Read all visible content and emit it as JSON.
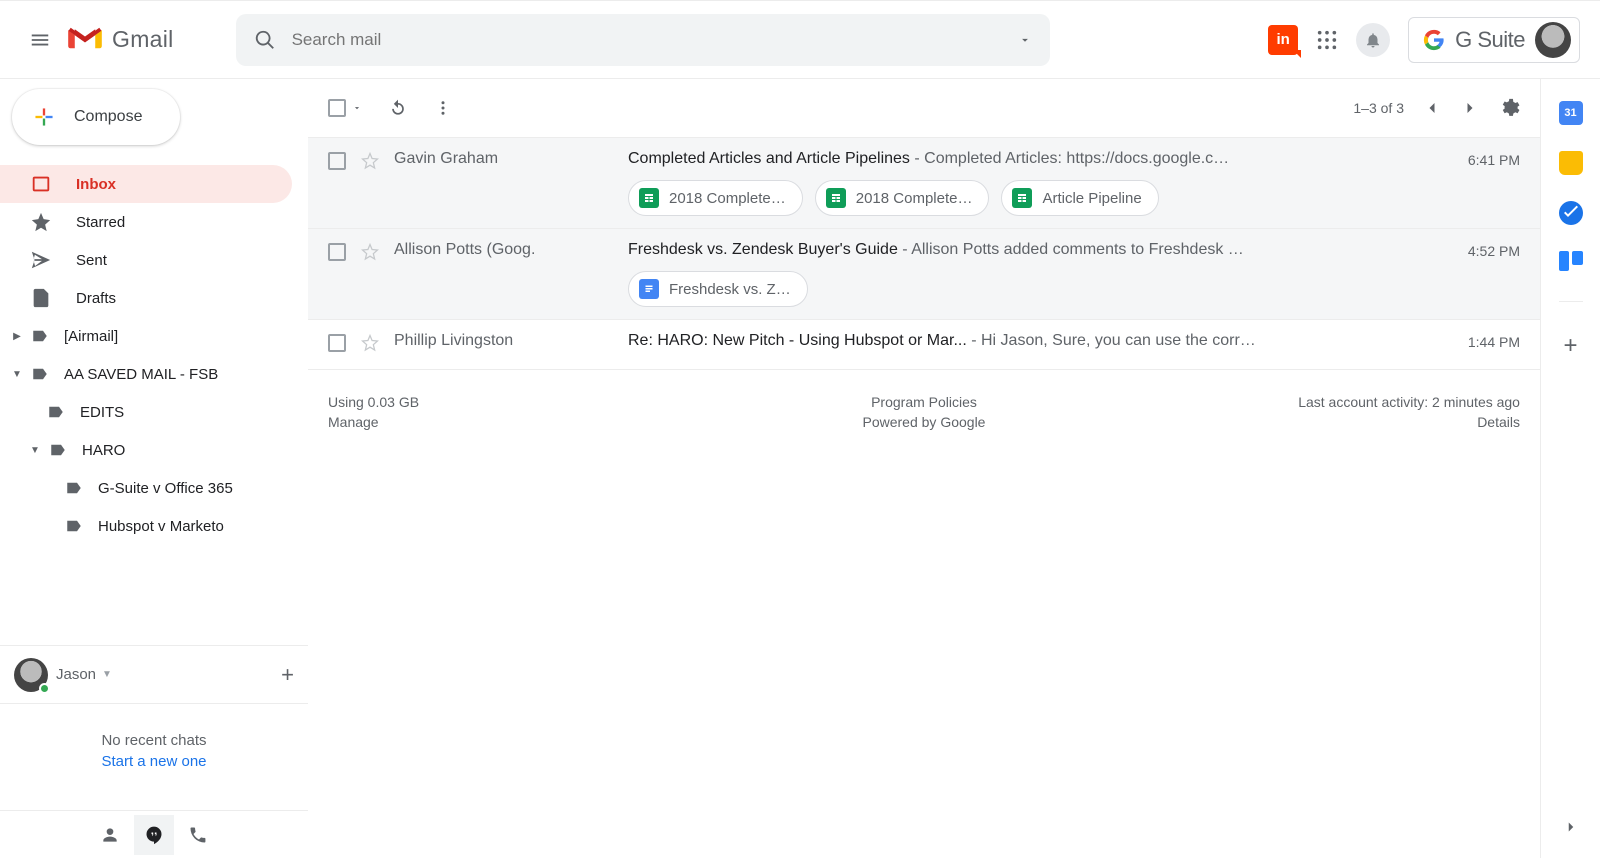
{
  "brand": "Gmail",
  "search": {
    "placeholder": "Search mail"
  },
  "gsuite_label": "G Suite",
  "compose_label": "Compose",
  "nav": {
    "inbox": "Inbox",
    "starred": "Starred",
    "sent": "Sent",
    "drafts": "Drafts"
  },
  "labels": {
    "airmail": "[Airmail]",
    "aa_saved": "AA SAVED MAIL - FSB",
    "edits": "EDITS",
    "haro": "HARO",
    "gsuite_office": "G-Suite v Office 365",
    "hubspot_marketo": "Hubspot v Marketo"
  },
  "chat": {
    "user": "Jason",
    "empty_l1": "No recent chats",
    "empty_l2": "Start a new one"
  },
  "toolbar": {
    "range": "1–3 of 3"
  },
  "messages": [
    {
      "sender": "Gavin Graham",
      "subject": "Completed Articles and Article Pipelines",
      "snippet": "Completed Articles: https://docs.google.c…",
      "time": "6:41 PM",
      "chips": [
        {
          "type": "sheets",
          "label": "2018 Complete…"
        },
        {
          "type": "sheets",
          "label": "2018 Complete…"
        },
        {
          "type": "sheets",
          "label": "Article Pipeline"
        }
      ]
    },
    {
      "sender": "Allison Potts (Goog.",
      "subject": "Freshdesk vs. Zendesk Buyer's Guide",
      "snippet": "Allison Potts added comments to Freshdesk …",
      "time": "4:52 PM",
      "chips": [
        {
          "type": "docs",
          "label": "Freshdesk vs. Z…"
        }
      ]
    },
    {
      "sender": "Phillip Livingston",
      "subject": "Re: HARO: New Pitch - Using Hubspot or Mar...",
      "snippet": "Hi Jason, Sure, you can use the corr…",
      "time": "1:44 PM",
      "chips": []
    }
  ],
  "footer": {
    "storage": "Using 0.03 GB",
    "manage": "Manage",
    "policies": "Program Policies",
    "powered": "Powered by Google",
    "activity": "Last account activity: 2 minutes ago",
    "details": "Details"
  }
}
